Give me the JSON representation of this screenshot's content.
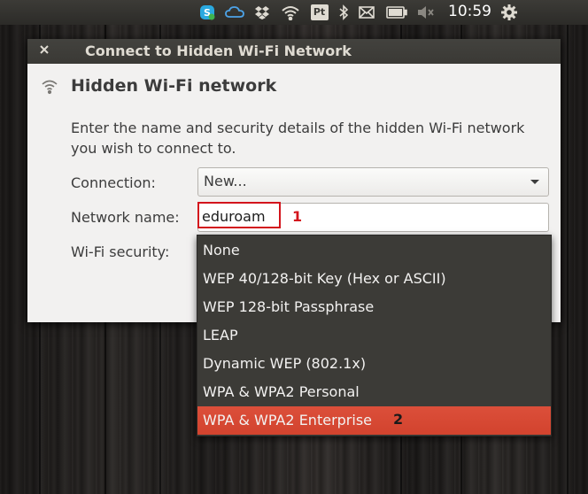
{
  "panel": {
    "clock": "10:59",
    "indicator_text": "Pt",
    "icons": [
      "skype-icon",
      "cloud-icon",
      "dropbox-icon",
      "wifi-icon",
      "pt-icon",
      "bluetooth-icon",
      "mail-icon",
      "battery-icon",
      "volume-muted-icon",
      "settings-gear-icon"
    ]
  },
  "dialog": {
    "title": "Connect to Hidden Wi-Fi Network",
    "heading": "Hidden Wi-Fi network",
    "description": "Enter the name and security details of the hidden Wi-Fi network you wish to connect to.",
    "connection_label": "Connection:",
    "connection_value": "New...",
    "network_name_label": "Network name:",
    "network_name_value": "eduroam",
    "security_label": "Wi-Fi security:"
  },
  "annotations": {
    "marker1": "1",
    "marker2": "2",
    "color": "#d3141c"
  },
  "security_options": [
    "None",
    "WEP 40/128-bit Key (Hex or ASCII)",
    "WEP 128-bit Passphrase",
    "LEAP",
    "Dynamic WEP (802.1x)",
    "WPA & WPA2 Personal",
    "WPA & WPA2 Enterprise"
  ],
  "selected_option": "WPA & WPA2 Enterprise",
  "colors": {
    "accent_selected": "#dc4f3a",
    "menu_bg": "#3c3b37",
    "panel_bg": "#3c3b37",
    "dialog_bg": "#f2f1f0"
  }
}
